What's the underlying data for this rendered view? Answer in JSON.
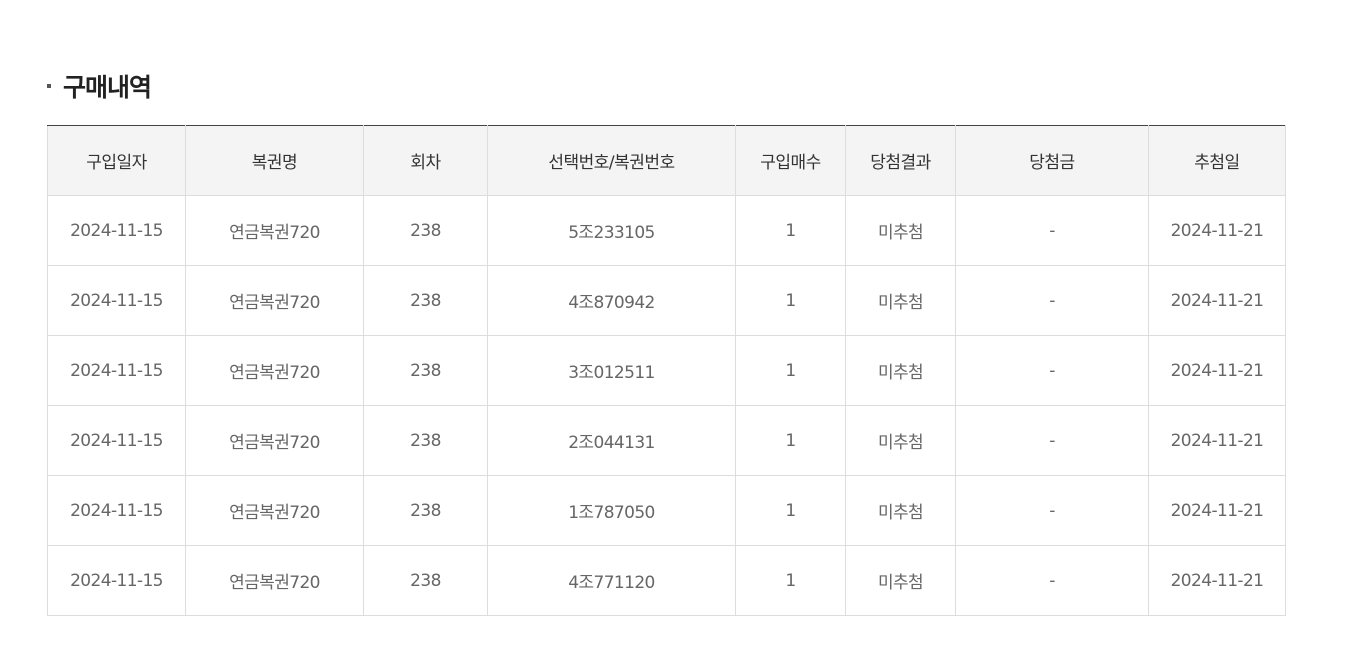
{
  "section": {
    "title": "구매내역"
  },
  "table": {
    "headers": [
      "구입일자",
      "복권명",
      "회차",
      "선택번호/복권번호",
      "구입매수",
      "당첨결과",
      "당첨금",
      "추첨일"
    ],
    "rows": [
      [
        "2024-11-15",
        "연금복권720",
        "238",
        "5조233105",
        "1",
        "미추첨",
        "-",
        "2024-11-21"
      ],
      [
        "2024-11-15",
        "연금복권720",
        "238",
        "4조870942",
        "1",
        "미추첨",
        "-",
        "2024-11-21"
      ],
      [
        "2024-11-15",
        "연금복권720",
        "238",
        "3조012511",
        "1",
        "미추첨",
        "-",
        "2024-11-21"
      ],
      [
        "2024-11-15",
        "연금복권720",
        "238",
        "2조044131",
        "1",
        "미추첨",
        "-",
        "2024-11-21"
      ],
      [
        "2024-11-15",
        "연금복권720",
        "238",
        "1조787050",
        "1",
        "미추첨",
        "-",
        "2024-11-21"
      ],
      [
        "2024-11-15",
        "연금복권720",
        "238",
        "4조771120",
        "1",
        "미추첨",
        "-",
        "2024-11-21"
      ]
    ]
  }
}
